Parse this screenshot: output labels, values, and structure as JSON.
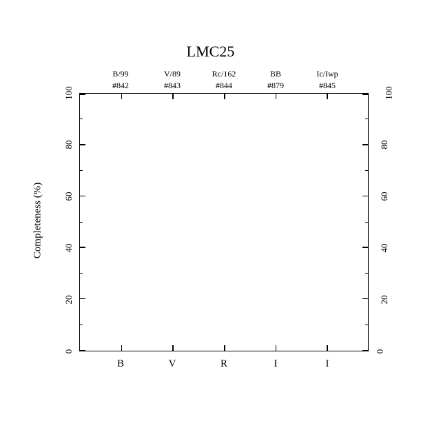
{
  "chart_data": {
    "type": "bar",
    "title": "LMC25",
    "ylabel": "Completeness (%)",
    "ylim": [
      0,
      100
    ],
    "yticks": [
      0,
      20,
      40,
      60,
      80,
      100
    ],
    "categories": [
      "B",
      "V",
      "R",
      "I",
      "I"
    ],
    "column_headers_top": [
      "B/99",
      "V/89",
      "Rc/162",
      "BB",
      "Ic/Iwp"
    ],
    "column_headers_num": [
      "#842",
      "#843",
      "#844",
      "#879",
      "#845"
    ],
    "series": [
      {
        "name": "Completeness",
        "values": [
          null,
          null,
          null,
          null,
          null
        ]
      }
    ]
  }
}
